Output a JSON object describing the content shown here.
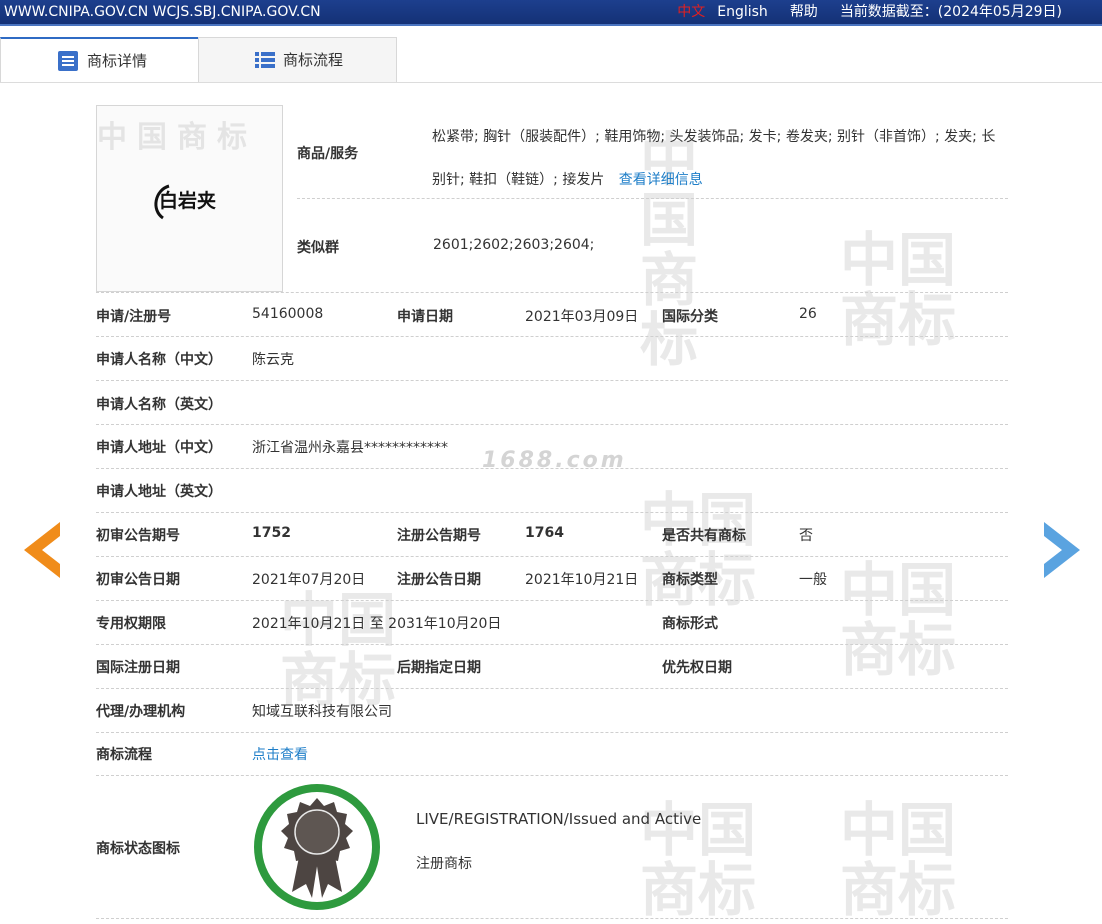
{
  "topbar": {
    "site": "WWW.CNIPA.GOV.CN WCJS.SBJ.CNIPA.GOV.CN",
    "lang_cn": "中文",
    "lang_en": "English",
    "help": "帮助",
    "data_date": "当前数据截至：(2024年05月29日)"
  },
  "tabs": [
    {
      "label": "商标详情",
      "icon": "list-doc-icon",
      "active": true
    },
    {
      "label": "商标流程",
      "icon": "list-icon",
      "active": false
    }
  ],
  "mark": {
    "logo_text": "白岩夹",
    "watermark": "中国商标",
    "site_watermark": "1688.com"
  },
  "goods": {
    "label": "商品/服务",
    "text": "松紧带; 胸针（服装配件）; 鞋用饰物; 头发装饰品; 发卡; 卷发夹; 别针（非首饰）; 发夹; 长别针; 鞋扣（鞋链）; 接发片",
    "link": "查看详细信息"
  },
  "similar": {
    "label": "类似群",
    "value": "2601;2602;2603;2604;"
  },
  "fields": {
    "reg_no_label": "申请/注册号",
    "reg_no": "54160008",
    "app_date_label": "申请日期",
    "app_date": "2021年03月09日",
    "intl_class_label": "国际分类",
    "intl_class": "26",
    "applicant_cn_label": "申请人名称（中文）",
    "applicant_cn": "陈云克",
    "applicant_en_label": "申请人名称（英文）",
    "address_cn_label": "申请人地址（中文）",
    "address_cn": "浙江省温州永嘉县************",
    "address_en_label": "申请人地址（英文）",
    "prelim_no_label": "初审公告期号",
    "prelim_no": "1752",
    "reg_pub_no_label": "注册公告期号",
    "reg_pub_no": "1764",
    "shared_label": "是否共有商标",
    "shared": "否",
    "prelim_date_label": "初审公告日期",
    "prelim_date": "2021年07月20日",
    "reg_pub_date_label": "注册公告日期",
    "reg_pub_date": "2021年10月21日",
    "mark_type_label": "商标类型",
    "mark_type": "一般",
    "term_label": "专用权期限",
    "term": "2021年10月21日 至 2031年10月20日",
    "mark_form_label": "商标形式",
    "intl_reg_date_label": "国际注册日期",
    "later_date_label": "后期指定日期",
    "priority_date_label": "优先权日期",
    "agent_label": "代理/办理机构",
    "agent": "知域互联科技有限公司",
    "flow_label": "商标流程",
    "flow_link": "点击查看",
    "status_label": "商标状态图标",
    "status_en": "LIVE/REGISTRATION/Issued and Active",
    "status_cn": "注册商标"
  },
  "colors": {
    "accent": "#1e7ec8",
    "arrow_prev": "#f08c1a",
    "arrow_next": "#5aa3e0",
    "badge_ring": "#2e9a3e"
  }
}
